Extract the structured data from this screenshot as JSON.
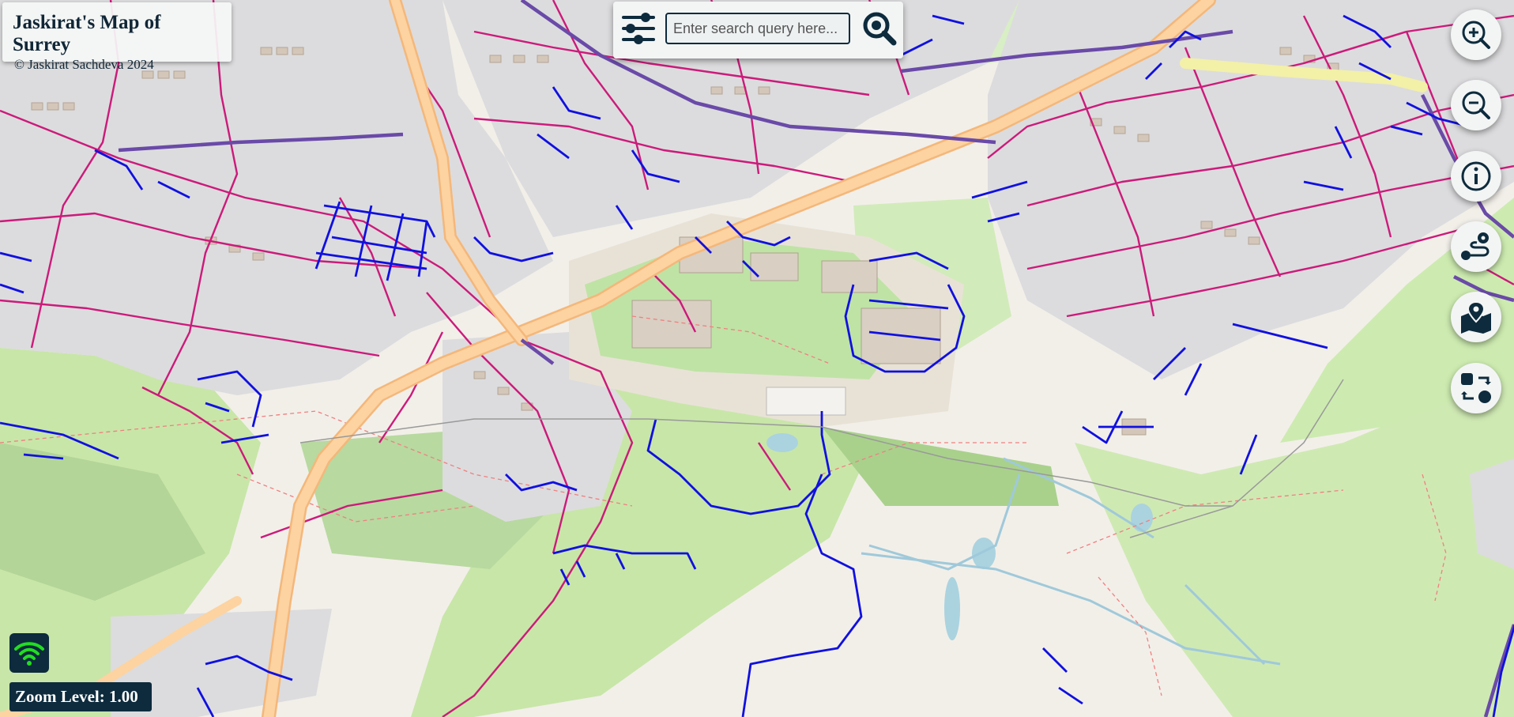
{
  "header": {
    "title": "Jaskirat's Map of Surrey",
    "copyright": "© Jaskirat Sachdeva 2024"
  },
  "search": {
    "placeholder": "Enter search query here..."
  },
  "icons": {
    "filter": "sliders-icon",
    "search": "search-magnifier-icon",
    "zoom_in": "zoom-in-icon",
    "zoom_out": "zoom-out-icon",
    "info": "info-icon",
    "route": "route-icon",
    "location": "map-pin-icon",
    "swap": "swap-icon",
    "connection": "wifi-icon"
  },
  "status": {
    "zoom_text": "Zoom Level: 1.00",
    "zoom_level": 1.0,
    "connection_color": "#22dd22"
  },
  "colors": {
    "panel_dark": "#0d2b3d",
    "main_road": "#cc1a7a",
    "footpath": "#1010e0",
    "trunk_road": "#fcc98a",
    "boundary": "#6a4aa8"
  }
}
